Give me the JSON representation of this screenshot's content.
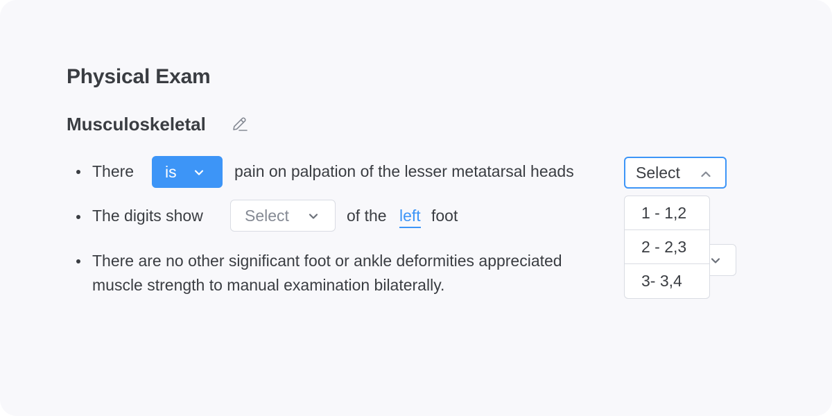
{
  "page": {
    "title": "Physical Exam"
  },
  "section": {
    "title": "Musculoskeletal",
    "edit_icon": "pencil-icon"
  },
  "bullets": [
    {
      "prefix": "There",
      "verb_select": {
        "value": "is",
        "state": "selected"
      },
      "middle": "pain on palpation of the lesser metatarsal heads",
      "location_select": {
        "value": "Select",
        "state": "open"
      }
    },
    {
      "prefix": "The digits show",
      "digits_select": {
        "value": "Select",
        "state": "empty"
      },
      "middle": "of the",
      "side_link": "left",
      "suffix": "foot"
    },
    {
      "line1": "There are no other significant foot or ankle deformities appreciated",
      "line2": "muscle strength to manual examination bilaterally."
    }
  ],
  "dropdown": {
    "options": [
      "1 - 1,2",
      "2 - 2,3",
      "3- 3,4"
    ]
  },
  "colors": {
    "accent": "#3d95f7",
    "text": "#3a3d42",
    "muted": "#858a94",
    "border": "#d9dce3",
    "background": "#f8f8fb"
  }
}
